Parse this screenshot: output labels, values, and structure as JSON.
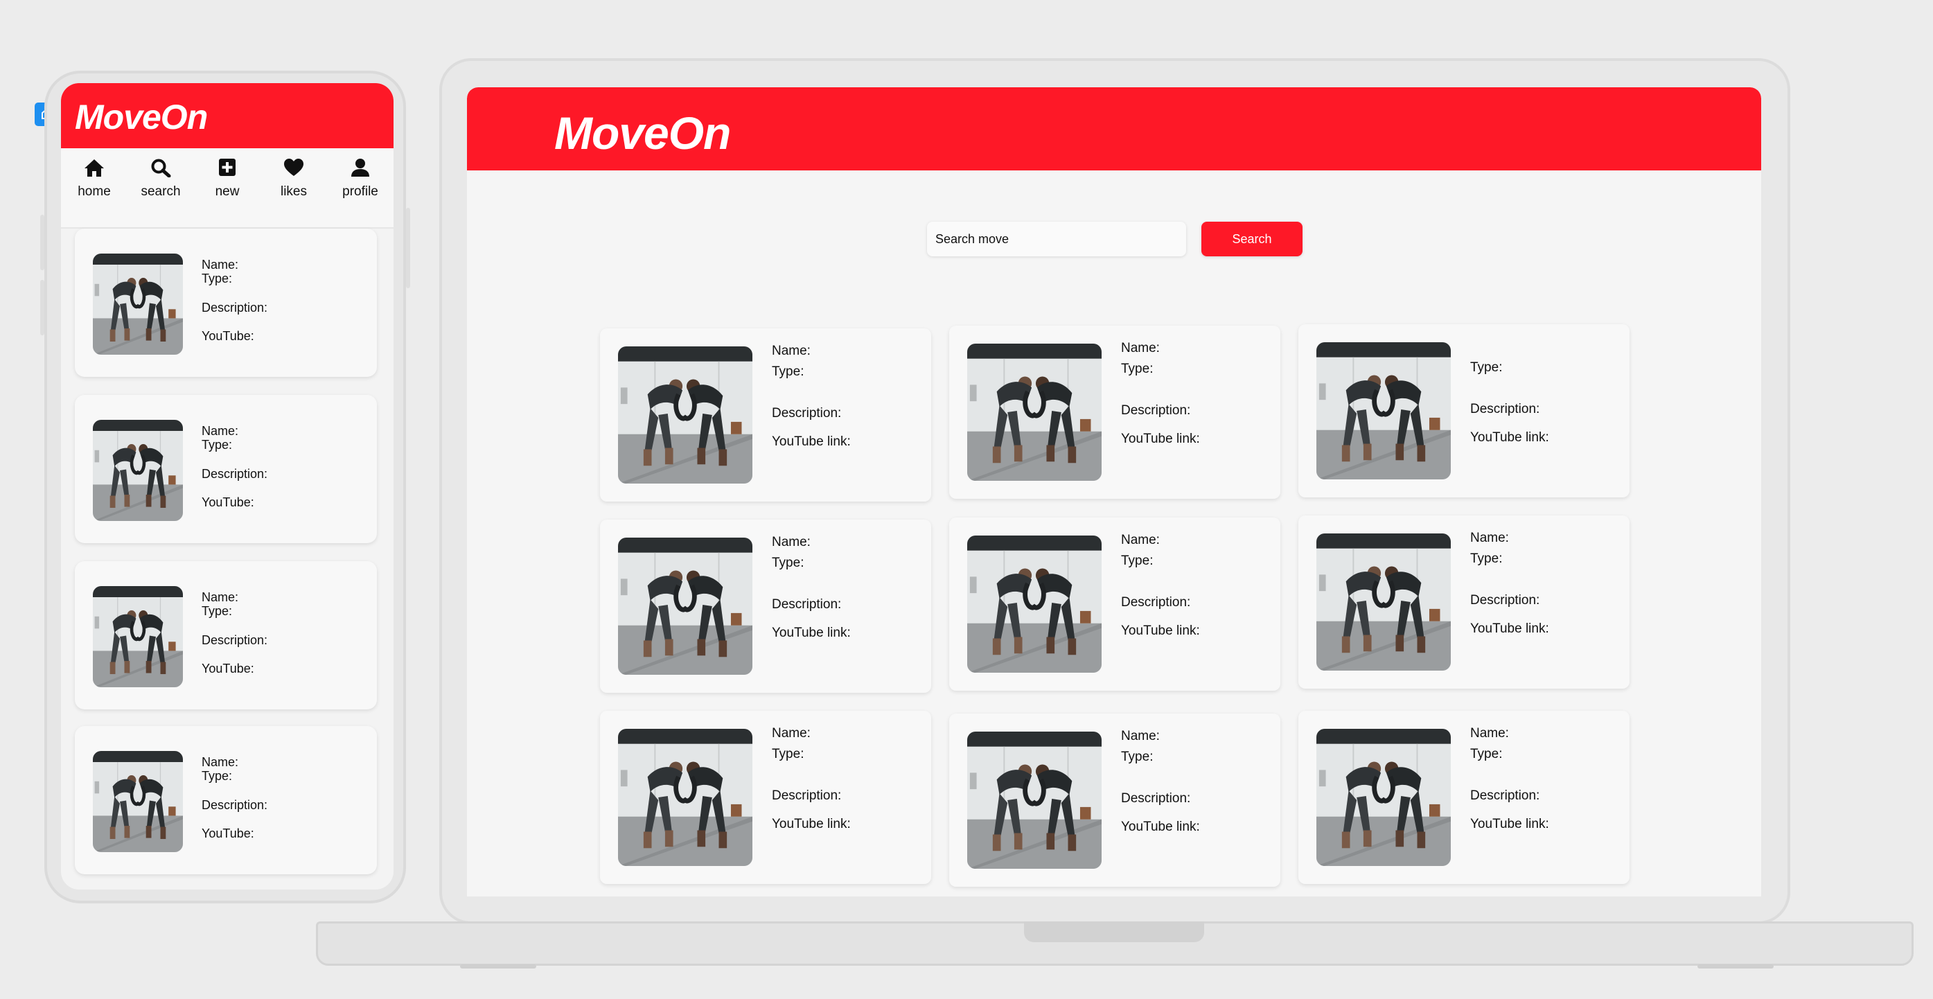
{
  "app": {
    "name": "MoveOn"
  },
  "mobile": {
    "nav": [
      {
        "label": "home",
        "icon": "home-icon"
      },
      {
        "label": "search",
        "icon": "search-icon"
      },
      {
        "label": "new",
        "icon": "plus-square-icon"
      },
      {
        "label": "likes",
        "icon": "heart-icon"
      },
      {
        "label": "profile",
        "icon": "user-icon"
      }
    ],
    "cards": [
      {
        "name": "Name:",
        "type": "Type:",
        "description": "Description:",
        "link": "YouTube:"
      },
      {
        "name": "Name:",
        "type": "Type:",
        "description": "Description:",
        "link": "YouTube:"
      },
      {
        "name": "Name:",
        "type": "Type:",
        "description": "Description:",
        "link": "YouTube:"
      },
      {
        "name": "Name:",
        "type": "Type:",
        "description": "Description:",
        "link": "YouTube:"
      }
    ]
  },
  "desktop": {
    "search": {
      "placeholder": "Search move",
      "button_label": "Search"
    },
    "cards": [
      {
        "name": "Name:",
        "type": "Type:",
        "description": "Description:",
        "link": "YouTube link:"
      },
      {
        "name": "Name:",
        "type": "Type:",
        "description": "Description:",
        "link": "YouTube link:"
      },
      {
        "name": "",
        "type": "Type:",
        "description": "Description:",
        "link": "YouTube link:"
      },
      {
        "name": "Name:",
        "type": "Type:",
        "description": "Description:",
        "link": "YouTube link:"
      },
      {
        "name": "Name:",
        "type": "Type:",
        "description": "Description:",
        "link": "YouTube link:"
      },
      {
        "name": "Name:",
        "type": "Type:",
        "description": "Description:",
        "link": "YouTube link:"
      },
      {
        "name": "Name:",
        "type": "Type:",
        "description": "Description:",
        "link": "YouTube link:"
      },
      {
        "name": "Name:",
        "type": "Type:",
        "description": "Description:",
        "link": "YouTube link:"
      },
      {
        "name": "Name:",
        "type": "Type:",
        "description": "Description:",
        "link": "YouTube link:"
      }
    ]
  },
  "colors": {
    "brand_red": "#fe1827",
    "background": "#ececec",
    "card": "#f8f8f8"
  }
}
